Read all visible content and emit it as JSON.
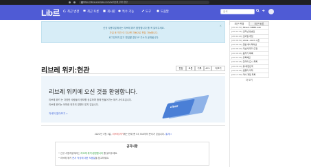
{
  "browser": {
    "url": "https://libre.example.com/w/리브레_위키:현관"
  },
  "navbar": {
    "logo": "Lib르",
    "items": [
      {
        "label": "최근 변경",
        "icon": "refresh-icon"
      },
      {
        "label": "최근 토론",
        "icon": "comments-icon"
      },
      {
        "label": "게시판",
        "icon": "board-icon"
      },
      {
        "label": "특수 기능",
        "icon": "cube-icon"
      },
      {
        "label": "도구",
        "icon": "wrench-icon"
      },
      {
        "label": "도움말",
        "icon": "question-icon"
      }
    ],
    "search_placeholder": "검색"
  },
  "notice": {
    "line1": "신규 사용자분께서는 리브레 위키 환영합니다 를 꼭 읽어주세요.",
    "line2": "가입 후 약간 이 지나면 자동으로 편집 가능합니다.",
    "line3": "로그인하지 않고 편집할 경우 IP 주소가 공개됩니다."
  },
  "page": {
    "title": "리브레 위키:현관",
    "tools": [
      "편집",
      "토론",
      "기록",
      "ACL",
      "더보기"
    ]
  },
  "welcome": {
    "title": "리브레 위키에 오신 것을 환영합니다.",
    "desc1": "리브레 위키 는 다양한 사람들의 정보를 공유하며 함께 만들어가는 위키 사이트입니다.",
    "desc2": "리브레 위키는 어떠한 외부의 영향도 받지 않습니다.",
    "link": "자세히 알아보기 »",
    "illus_logo": "Libre"
  },
  "stats": {
    "pre": "2022년 3월 1일, ",
    "site": "리브레 위키",
    "mid": "에는 현재 총 ",
    "count": "53,748",
    "post": "개의 문서가 있습니다. ",
    "link": "통계 »"
  },
  "notice_box": {
    "title": "공지사항",
    "item1_pre": "• 신규 사용자분께서는 ",
    "item1_hl": "리브레 위키:환영합니다",
    "item1_post": " 를 읽어주세요.",
    "item2_pre": "• 리브레 위키 ",
    "item2_lk": "문서 작성에 대한 도움말",
    "item2_post": "을 참고하세요."
  },
  "sidebar": {
    "tabs": [
      "최근 변경",
      "최근 토론"
    ],
    "items": [
      {
        "time": "[20:44:50]",
        "title": "Mixed: BMBR wiki"
      },
      {
        "time": "[20:44:35]",
        "title": "인터넷 방송인"
      },
      {
        "time": "[20:44:20]",
        "title": "모바일 게임"
      },
      {
        "time": "[20:38:50]",
        "title": "2022~2023 시즌"
      },
      {
        "time": "[20:38:35]",
        "title": "일본 애니메이션"
      },
      {
        "time": "[20:38:20]",
        "title": "리브레 위키:규정"
      },
      {
        "time": "[20:38:05]",
        "title": "음악가 목록"
      },
      {
        "time": "[20:33:40]",
        "title": "블록체인"
      },
      {
        "time": "[20:30:25]",
        "title": "한국의 도시 목록"
      },
      {
        "time": "[20:28:10]",
        "title": "틀:대한민국"
      },
      {
        "time": "[20:26:55]",
        "title": "컴퓨터 과학"
      },
      {
        "time": "[20:17:50]",
        "title": "역사 게임 목록"
      },
      {
        "time": "[20:10:35]",
        "title": "Unicode"
      }
    ],
    "more": "더 보기"
  }
}
